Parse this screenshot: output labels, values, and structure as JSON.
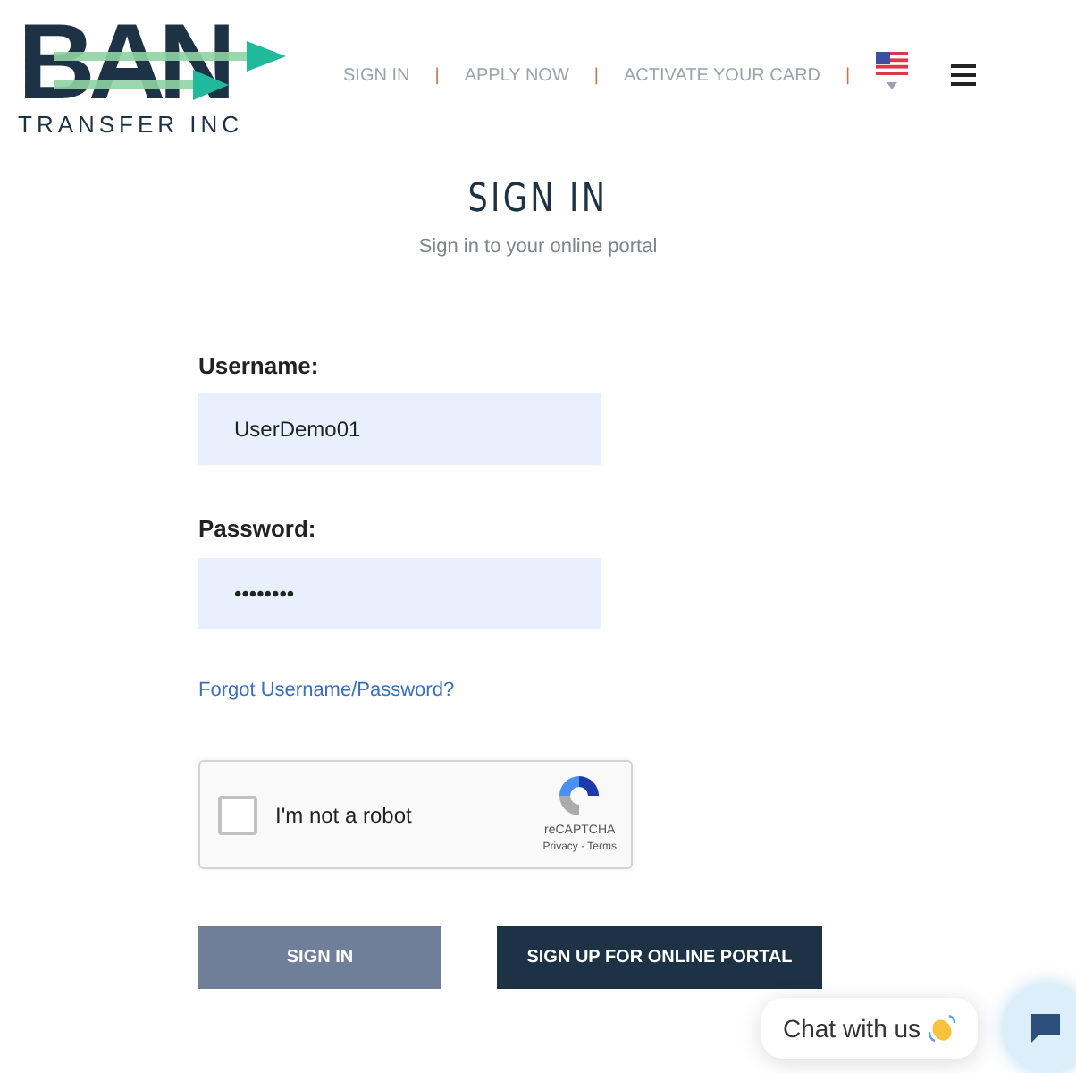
{
  "logo": {
    "wordmark": "BAN",
    "subtitle": "TRANSFER INC"
  },
  "nav": {
    "links": [
      "SIGN IN",
      "APPLY NOW",
      "ACTIVATE YOUR CARD"
    ],
    "separator": "|"
  },
  "header": {
    "title": "SIGN IN",
    "subtitle": "Sign in to your online portal"
  },
  "form": {
    "fields": [
      {
        "label": "Username:",
        "value": "UserDemo01"
      },
      {
        "label": "Password:",
        "value": "••••••••"
      }
    ],
    "forgot_link": "Forgot Username/Password?",
    "captcha": {
      "label": "I'm not a robot",
      "checked": false,
      "brand": "reCAPTCHA",
      "links": "Privacy - Terms"
    },
    "buttons": [
      {
        "label": "SIGN IN",
        "kind": "secondary"
      },
      {
        "label": "SIGN UP FOR ONLINE PORTAL",
        "kind": "primary"
      }
    ]
  },
  "chat": {
    "label": "Chat with us"
  }
}
